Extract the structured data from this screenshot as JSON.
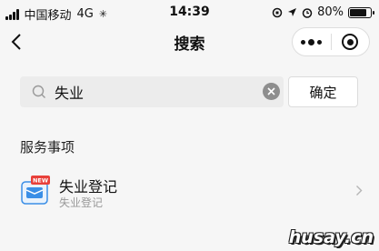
{
  "status_bar": {
    "carrier": "中国移动",
    "network": "4G",
    "time": "14:39",
    "battery_percent": "80%",
    "battery_level": 0.8
  },
  "nav": {
    "title": "搜索"
  },
  "search": {
    "value": "失业",
    "confirm_label": "确定"
  },
  "section": {
    "title": "服务事项"
  },
  "services": [
    {
      "title": "失业登记",
      "subtitle": "失业登记",
      "badge": "NEW"
    }
  ],
  "watermark": "husay.cn",
  "colors": {
    "background": "#f6f6f6",
    "search_bg": "#ececec",
    "icon_blue": "#3a8ee6",
    "badge_red": "#e8403a"
  }
}
